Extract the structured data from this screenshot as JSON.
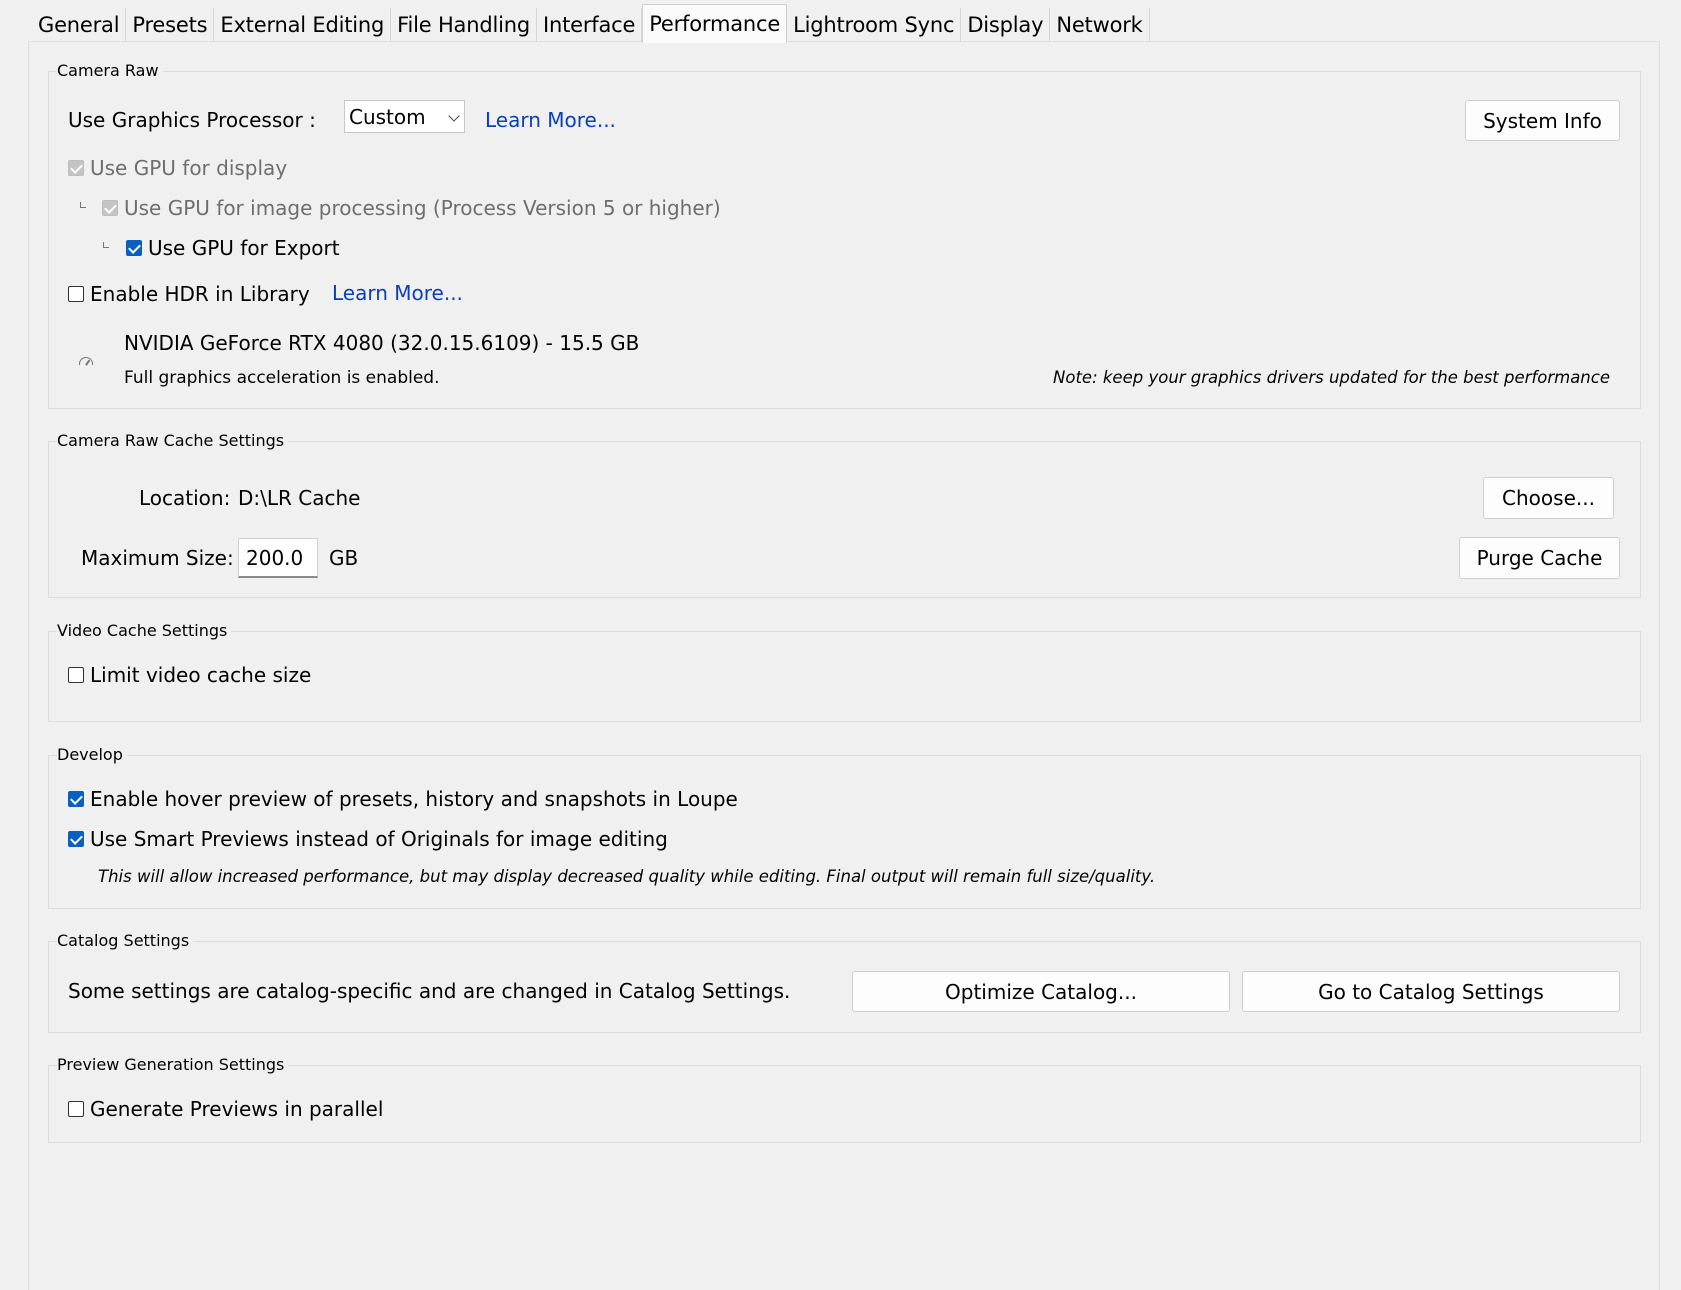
{
  "tabs": [
    {
      "label": "General"
    },
    {
      "label": "Presets"
    },
    {
      "label": "External Editing"
    },
    {
      "label": "File Handling"
    },
    {
      "label": "Interface"
    },
    {
      "label": "Performance",
      "active": true
    },
    {
      "label": "Lightroom Sync"
    },
    {
      "label": "Display"
    },
    {
      "label": "Network"
    }
  ],
  "camera_raw": {
    "legend": "Camera Raw",
    "gpu_label": "Use Graphics Processor :",
    "gpu_select_value": "Custom",
    "learn_more_1": "Learn More...",
    "system_info_button": "System Info",
    "use_gpu_display": "Use GPU for display",
    "use_gpu_processing": "Use GPU for image processing (Process Version 5 or higher)",
    "use_gpu_export": "Use GPU for Export",
    "enable_hdr": "Enable HDR in Library",
    "learn_more_2": "Learn More...",
    "gpu_name": "NVIDIA GeForce RTX 4080 (32.0.15.6109) - 15.5 GB",
    "accel_status": "Full graphics acceleration is enabled.",
    "driver_note": "Note: keep your graphics drivers updated for the best performance"
  },
  "cache": {
    "legend": "Camera Raw Cache Settings",
    "location_label": "Location:",
    "location_value": "D:\\LR Cache",
    "choose_button": "Choose...",
    "max_size_label": "Maximum Size:",
    "max_size_value": "200.0",
    "max_size_unit": "GB",
    "purge_button": "Purge Cache"
  },
  "video_cache": {
    "legend": "Video Cache Settings",
    "limit_label": "Limit video cache size"
  },
  "develop": {
    "legend": "Develop",
    "hover_preview": "Enable hover preview of presets, history and snapshots in Loupe",
    "smart_previews": "Use Smart Previews instead of Originals for image editing",
    "smart_note": "This will allow increased performance, but may display decreased quality while editing. Final output will remain full size/quality."
  },
  "catalog": {
    "legend": "Catalog Settings",
    "description": "Some settings are catalog-specific and are changed in Catalog Settings.",
    "optimize_button": "Optimize Catalog...",
    "goto_button": "Go to Catalog Settings"
  },
  "preview": {
    "legend": "Preview Generation Settings",
    "parallel_label": "Generate Previews in parallel"
  },
  "colors": {
    "accent_checkbox": "#0a5fbf",
    "link": "#0b3fb8",
    "background": "#f0f0f0"
  }
}
